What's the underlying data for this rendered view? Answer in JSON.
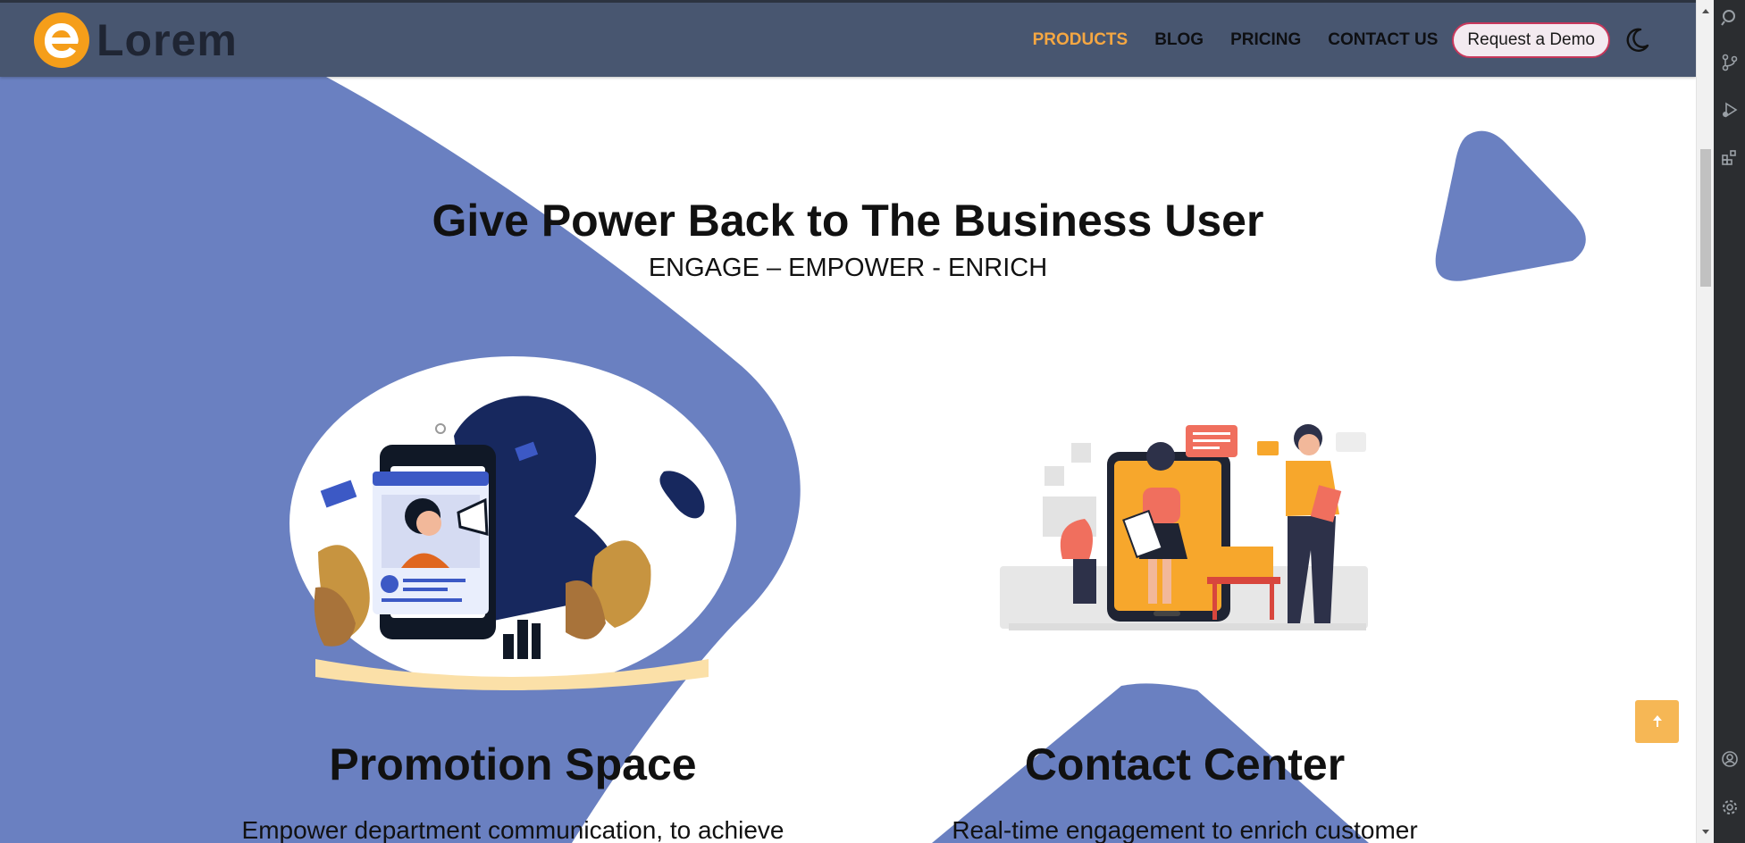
{
  "nav": {
    "logo_text": "Lorem",
    "links": [
      "PRODUCTS",
      "BLOG",
      "PRICING",
      "CONTACT US"
    ],
    "active_link": "PRODUCTS",
    "demo_button": "Request a Demo",
    "theme_toggle_icon": "moon-icon"
  },
  "hero": {
    "title": "Give Power Back to The Business User",
    "tagline": "ENGAGE – EMPOWER - ENRICH"
  },
  "features": [
    {
      "title": "Promotion Space",
      "description": "Empower department communication, to achieve",
      "illustration": "promotion-illustration"
    },
    {
      "title": "Contact Center",
      "description": "Real-time engagement to enrich customer",
      "illustration": "contact-center-illustration"
    }
  ],
  "scroll_top_icon": "arrow-up-icon",
  "colors": {
    "navbar": "#485670",
    "accent": "#f5a742",
    "shape": "#6a80c1",
    "logo": "#f59e1a",
    "demo_border": "#c7375b"
  }
}
